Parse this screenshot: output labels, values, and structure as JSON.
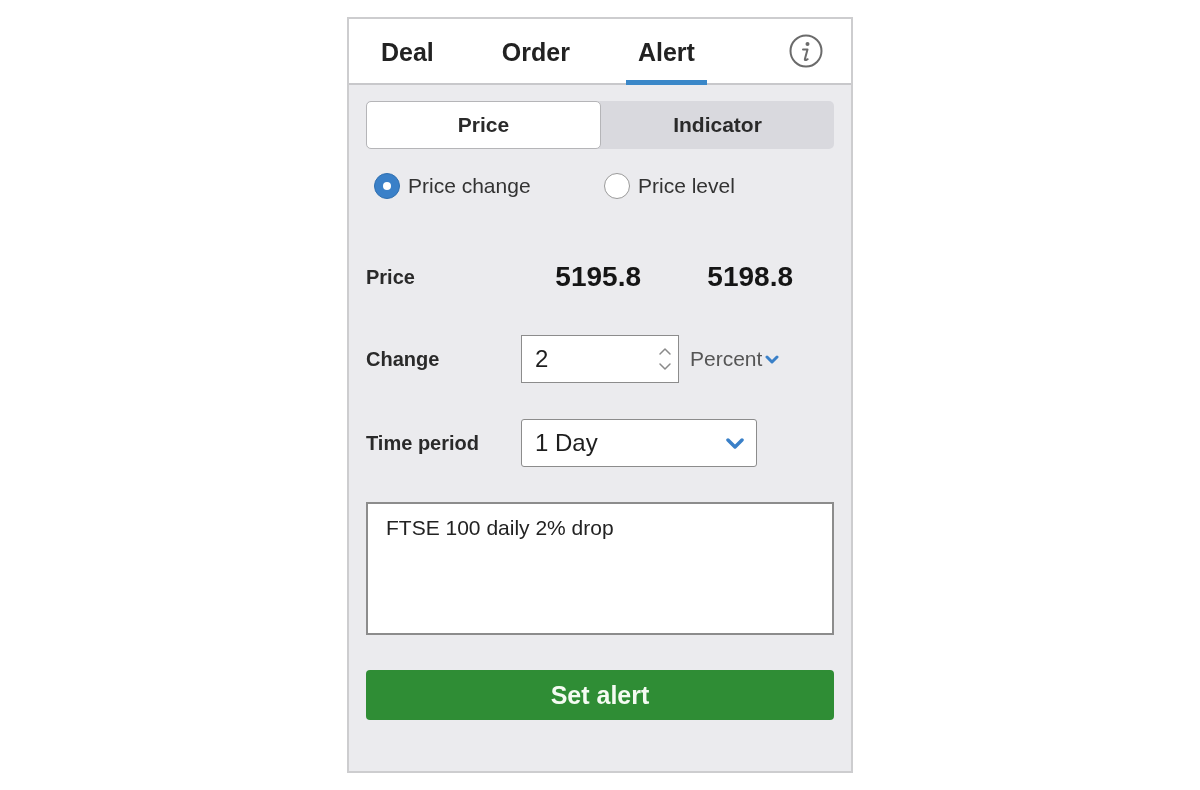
{
  "tabs": [
    {
      "label": "Deal",
      "selected": false
    },
    {
      "label": "Order",
      "selected": false
    },
    {
      "label": "Alert",
      "selected": true
    }
  ],
  "segments": [
    {
      "label": "Price",
      "selected": true
    },
    {
      "label": "Indicator",
      "selected": false
    }
  ],
  "alert_types": [
    {
      "label": "Price change",
      "selected": true
    },
    {
      "label": "Price level",
      "selected": false
    }
  ],
  "price": {
    "label": "Price",
    "values": [
      "5195.8",
      "5198.8"
    ]
  },
  "change": {
    "label": "Change",
    "value": "2",
    "unit": "Percent"
  },
  "time_period": {
    "label": "Time period",
    "value": "1 Day"
  },
  "note": {
    "value": "FTSE 100 daily 2% drop"
  },
  "buttons": [
    {
      "label": "Set alert"
    }
  ]
}
